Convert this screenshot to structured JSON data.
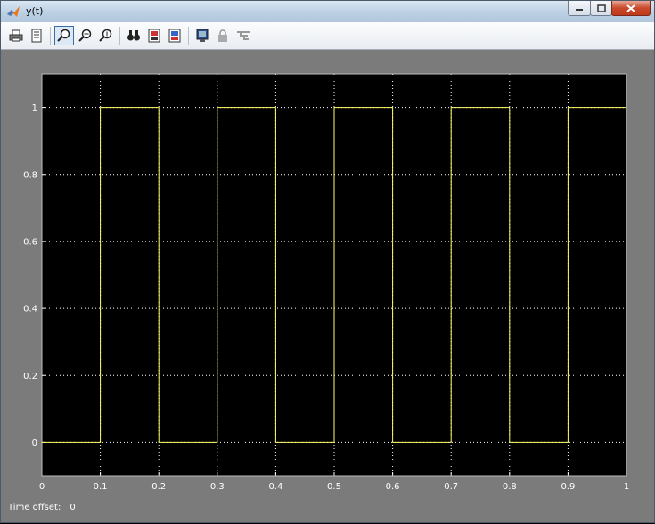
{
  "window": {
    "title": "y(t)"
  },
  "toolbar": {
    "buttons": [
      "print-icon",
      "parameters-icon",
      "zoom-icon",
      "zoom-x-icon",
      "zoom-y-icon",
      "autoscale-icon",
      "save-axes-icon",
      "restore-axes-icon",
      "floating-scope-icon",
      "lock-icon",
      "signal-selection-icon"
    ],
    "active": "zoom-icon"
  },
  "status": {
    "label": "Time offset:",
    "value": "0"
  },
  "colors": {
    "background": "#000000",
    "trace": "#ffff66",
    "frame": "#7b7b7b",
    "grid": "#ffffff"
  },
  "chart_data": {
    "type": "line",
    "title": "",
    "xlabel": "",
    "ylabel": "",
    "xlim": [
      0,
      1
    ],
    "ylim": [
      -0.1,
      1.1
    ],
    "grid": true,
    "xticks": [
      "0",
      "0.1",
      "0.2",
      "0.3",
      "0.4",
      "0.5",
      "0.6",
      "0.7",
      "0.8",
      "0.9",
      "1"
    ],
    "yticks": [
      "0",
      "0.2",
      "0.4",
      "0.6",
      "0.8",
      "1"
    ],
    "series": [
      {
        "x": [
          0,
          0.1,
          0.1,
          0.1,
          0.2,
          0.2,
          0.3,
          0.3,
          0.3,
          0.4,
          0.4,
          0.4,
          0.5,
          0.5,
          0.6,
          0.6,
          0.6,
          0.7,
          0.7,
          0.8,
          0.8,
          0.8,
          0.9,
          0.9,
          0.9,
          1
        ],
        "y": [
          0,
          0,
          0.5,
          1,
          1,
          0,
          0,
          0.5,
          1,
          1,
          0.5,
          0,
          0,
          1,
          1,
          0.5,
          0,
          0,
          1,
          1,
          0.5,
          0,
          0,
          0.5,
          1,
          1
        ]
      }
    ]
  }
}
